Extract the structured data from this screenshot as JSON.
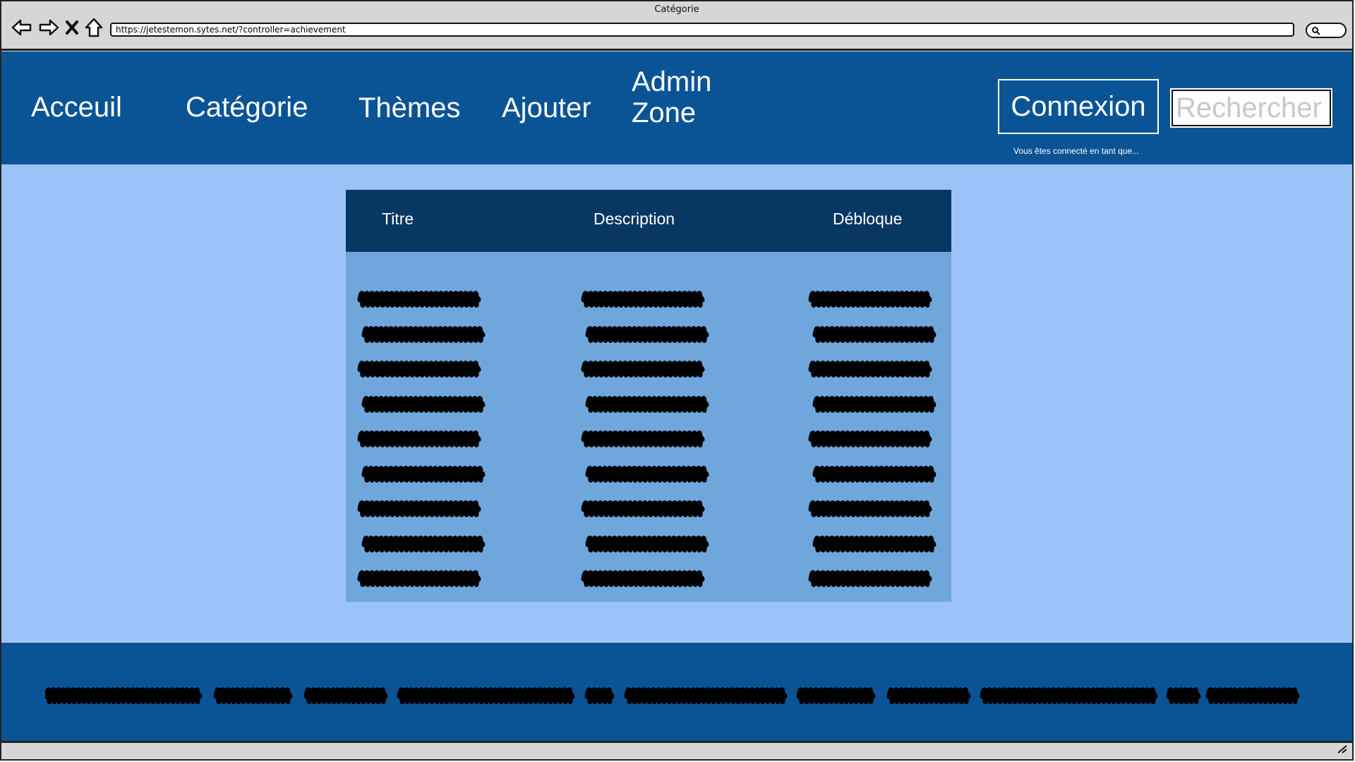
{
  "browser": {
    "window_title": "Catégorie",
    "url": "https://jetestemon.sytes.net/?controller=achievement"
  },
  "header": {
    "nav": [
      {
        "label": "Acceuil"
      },
      {
        "label": "Catégorie"
      },
      {
        "label": "Thèmes"
      },
      {
        "label": "Ajouter"
      },
      {
        "label": "Admin Zone"
      }
    ],
    "login_button": "Connexion",
    "search_placeholder": "Rechercher",
    "connected_note": "Vous êtes connecté en tant que..."
  },
  "table": {
    "columns": [
      "Titre",
      "Description",
      "Débloque"
    ],
    "row_count": 9,
    "cells": "placeholder scribbles (illegible)"
  },
  "footer": {
    "text": "placeholder scribble line (illegible)"
  },
  "icons": [
    "back-arrow-icon",
    "forward-arrow-icon",
    "close-icon",
    "home-icon",
    "search-icon",
    "resize-grip-icon"
  ],
  "colors": {
    "header_bg": "#0a5496",
    "content_bg": "#9dc2f7",
    "table_header_bg": "#073763",
    "table_body_bg": "#6fa7dd"
  }
}
